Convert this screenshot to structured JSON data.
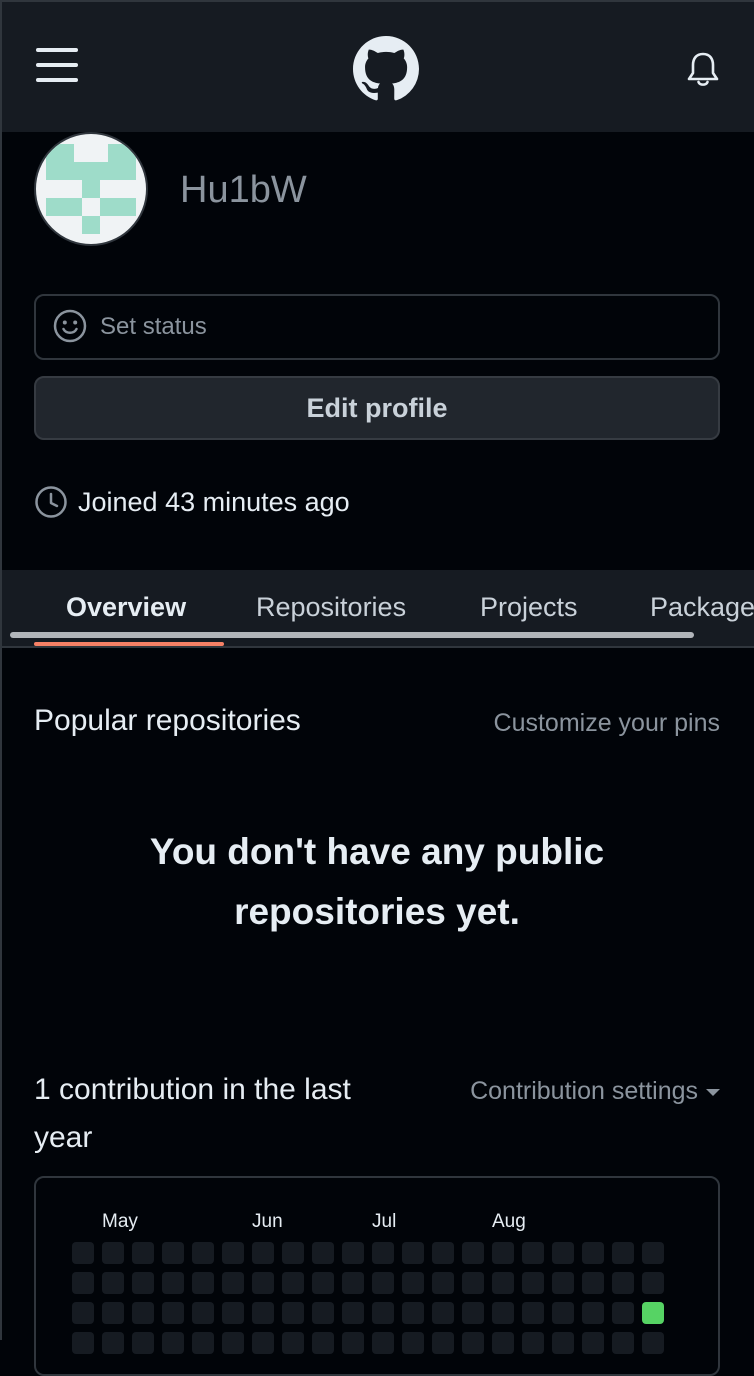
{
  "header": {
    "menu_icon": "hamburger-menu-icon",
    "logo_icon": "github-octocat-logo",
    "notification_icon": "bell-icon"
  },
  "profile": {
    "username": "Hu1bW",
    "set_status": "Set status",
    "edit_profile": "Edit profile",
    "joined": "Joined 43 minutes ago"
  },
  "tabs": [
    {
      "label": "Overview",
      "active": true
    },
    {
      "label": "Repositories",
      "active": false
    },
    {
      "label": "Projects",
      "active": false
    },
    {
      "label": "Packages",
      "active": false
    }
  ],
  "popular": {
    "title": "Popular repositories",
    "customize": "Customize your pins",
    "empty_message": "You don't have any public repositories yet."
  },
  "contributions": {
    "title": "1 contribution in the last year",
    "settings_label": "Contribution settings",
    "months": [
      "May",
      "Jun",
      "Jul",
      "Aug"
    ],
    "visible_weeks": 20,
    "visible_days": 4,
    "contributed_cell": {
      "week": 19,
      "day": 2
    },
    "colors": {
      "empty": "#161b22",
      "level_1": "#56d364"
    }
  },
  "colors": {
    "background": "#010409",
    "header": "#161b22",
    "accent_underline": "#f78166",
    "muted_text": "#8b949e",
    "border": "#30363d"
  }
}
